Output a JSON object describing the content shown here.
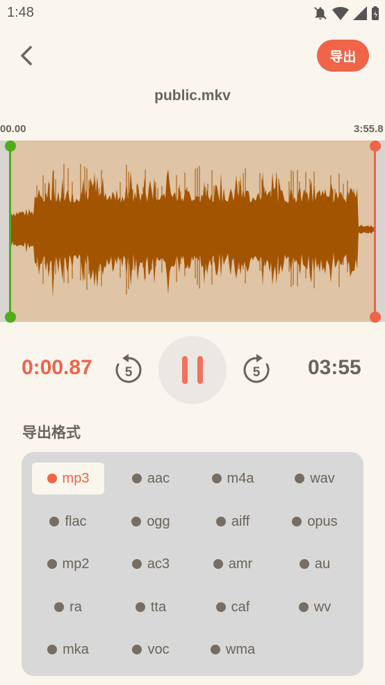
{
  "status_bar": {
    "time": "1:48",
    "icons": [
      "notifications-off-icon",
      "wifi-icon",
      "signal-icon",
      "battery-charging-icon"
    ]
  },
  "header": {
    "back_icon": "chevron-left-icon",
    "export_label": "导出"
  },
  "file_name": "public.mkv",
  "timeline": {
    "start_label": "00.00",
    "end_label": "3:55.8"
  },
  "player": {
    "current_time": "0:00.87",
    "total_time": "03:55",
    "rewind_seconds": "5",
    "forward_seconds": "5",
    "state": "playing",
    "rewind_icon": "replay-5-icon",
    "forward_icon": "forward-5-icon",
    "pause_icon": "pause-icon"
  },
  "formats": {
    "title": "导出格式",
    "selected": "mp3",
    "items": [
      "mp3",
      "aac",
      "m4a",
      "wav",
      "flac",
      "ogg",
      "aiff",
      "opus",
      "mp2",
      "ac3",
      "amr",
      "au",
      "ra",
      "tta",
      "caf",
      "wv",
      "mka",
      "voc",
      "wma"
    ]
  },
  "colors": {
    "accent": "#f06448",
    "start_handle": "#4caf1a",
    "end_handle": "#f06448",
    "waveform": "#a35400",
    "selection_bg": "#dfc4a6",
    "background": "#faf6ee"
  }
}
